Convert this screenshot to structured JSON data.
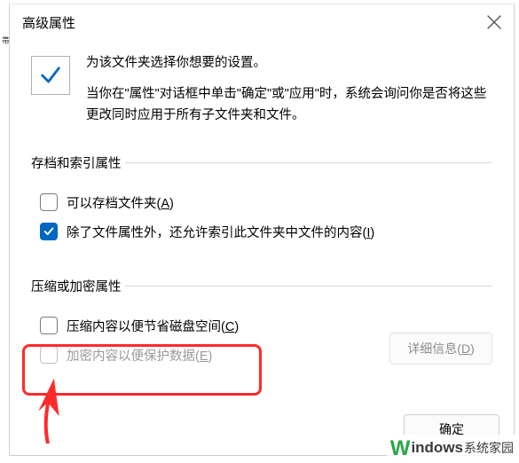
{
  "dialog": {
    "title": "高级属性",
    "intro": {
      "heading": "为该文件夹选择你想要的设置。",
      "body": "当你在\"属性\"对话框中单击\"确定\"或\"应用\"时，系统会询问你是否将这些更改同时应用于所有子文件夹和文件。"
    },
    "groups": {
      "archive": {
        "legend": "存档和索引属性",
        "items": [
          {
            "label_pre": "可以存档文件夹(",
            "hotkey": "A",
            "label_post": ")",
            "checked": false,
            "disabled": false
          },
          {
            "label_pre": "除了文件属性外，还允许索引此文件夹中文件的内容(",
            "hotkey": "I",
            "label_post": ")",
            "checked": true,
            "disabled": false
          }
        ]
      },
      "compress": {
        "legend": "压缩或加密属性",
        "items": [
          {
            "label_pre": "压缩内容以便节省磁盘空间(",
            "hotkey": "C",
            "label_post": ")",
            "checked": false,
            "disabled": false
          },
          {
            "label_pre": "加密内容以便保护数据(",
            "hotkey": "E",
            "label_post": ")",
            "checked": false,
            "disabled": true
          }
        ],
        "detail_btn_pre": "详细信息(",
        "detail_btn_hotkey": "D",
        "detail_btn_post": ")"
      }
    },
    "footer": {
      "ok": "确定"
    }
  },
  "watermark": {
    "logo": "W",
    "text_main": "indows",
    "text_sub": "系统家园"
  },
  "left_fragment": "帯"
}
